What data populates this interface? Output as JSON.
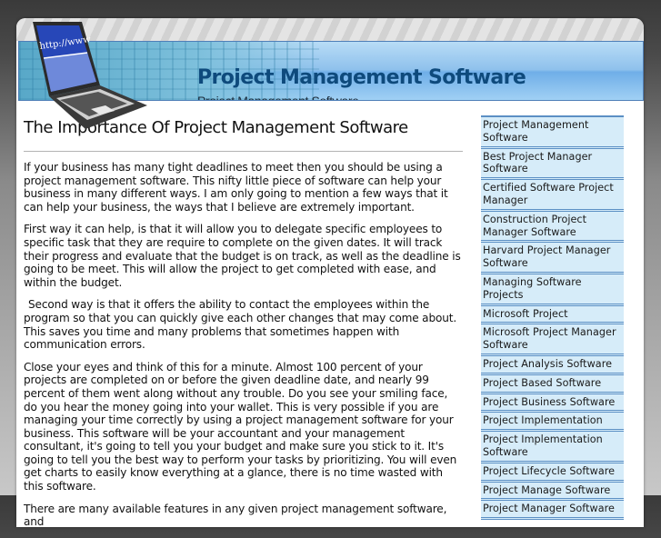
{
  "header": {
    "title": "Project Management Software",
    "subtitle": "Project Management Software",
    "logo_screen_text": "http://www"
  },
  "article": {
    "title": "The Importance Of Project Management Software",
    "paragraphs": [
      "If your business has many tight deadlines to meet then you should be using a project management software. This nifty little piece of software can help your business in many different ways. I am only going to mention a few ways that it can help your business, the ways that I believe are extremely important.",
      "First way it can help, is that it will allow you to delegate specific employees to specific task that they are require to complete on the given dates. It will track their progress and evaluate that the budget is on track, as well as the deadline is going to be meet. This will allow the project to get completed with ease, and within the budget.",
      "Second way is that it offers the ability to contact the employees within the program so that you can quickly give each other changes that may come about. This saves you time and many problems that sometimes happen with communication errors.",
      "Close your eyes and think of this for a minute. Almost 100 percent of your projects are completed on or before the given deadline date, and nearly 99 percent of them went along without any trouble. Do you see your smiling face, do you hear the money going into your wallet. This is very possible if you are managing your time correctly by using a project management software for your business. This software will be your accountant and your management consultant, it's going to tell you your budget and make sure you stick to it. It's going to tell you the best way to perform your tasks by prioritizing. You will even get charts to easily know everything at a glance, there is no time wasted with this software.",
      "There are many available features in any given project management software, and"
    ]
  },
  "sidebar": {
    "items": [
      {
        "label": "Project Management Software"
      },
      {
        "label": "Best Project Manager Software"
      },
      {
        "label": "Certified Software Project Manager"
      },
      {
        "label": "Construction Project Manager Software"
      },
      {
        "label": "Harvard Project Manager Software"
      },
      {
        "label": "Managing Software Projects"
      },
      {
        "label": "Microsoft Project"
      },
      {
        "label": "Microsoft Project Manager Software"
      },
      {
        "label": "Project Analysis Software"
      },
      {
        "label": "Project Based Software"
      },
      {
        "label": "Project Business Software"
      },
      {
        "label": "Project Implementation"
      },
      {
        "label": "Project Implementation Software"
      },
      {
        "label": "Project Lifecycle Software"
      },
      {
        "label": "Project Manage Software"
      },
      {
        "label": "Project Manager Software"
      }
    ]
  },
  "colors": {
    "title": "#0e4a7c",
    "sidebar_bg": "#d6ecf9",
    "sidebar_border": "#5b8fc4"
  }
}
